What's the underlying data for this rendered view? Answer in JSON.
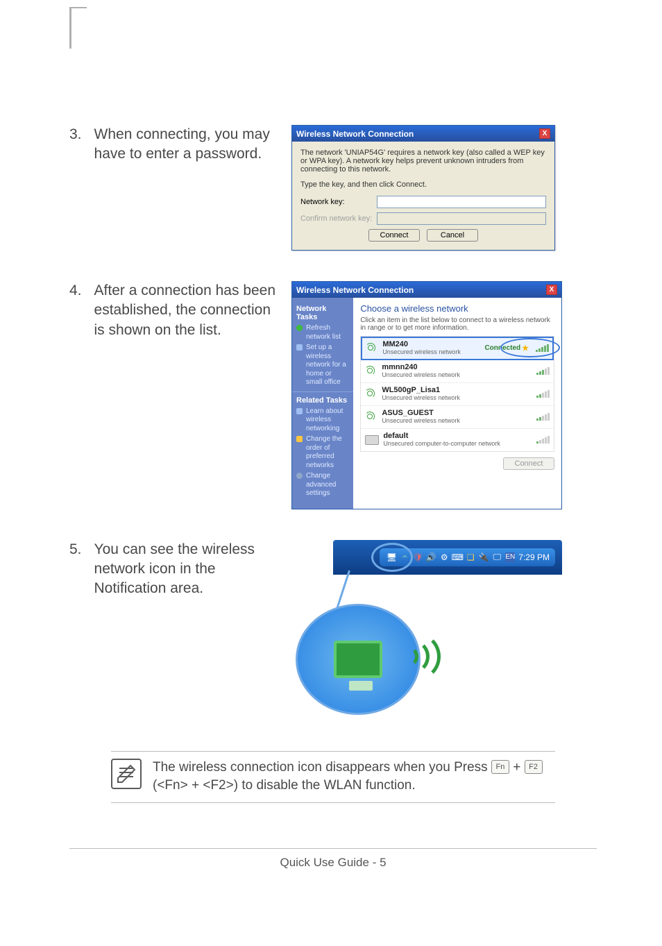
{
  "steps": {
    "s3": {
      "num": "3.",
      "text": "When connecting, you may have to enter a password."
    },
    "s4": {
      "num": "4.",
      "text": "After a connection has been established, the connection is shown on the list."
    },
    "s5": {
      "num": "5.",
      "text": "You can see the wireless network icon in the Notification area."
    }
  },
  "dialog_password": {
    "title": "Wireless Network Connection",
    "message": "The network 'UNIAP54G' requires a network key (also called a WEP key or WPA key). A network key helps prevent unknown intruders from connecting to this network.",
    "instruction": "Type the key, and then click Connect.",
    "label_key": "Network key:",
    "label_confirm": "Confirm network key:",
    "btn_connect": "Connect",
    "btn_cancel": "Cancel",
    "close_x": "X"
  },
  "dialog_list": {
    "title": "Wireless Network Connection",
    "close_x": "X",
    "side": {
      "hdr1": "Network Tasks",
      "task_refresh": "Refresh network list",
      "task_setup": "Set up a wireless network for a home or small office",
      "hdr2": "Related Tasks",
      "task_learn": "Learn about wireless networking",
      "task_order": "Change the order of preferred networks",
      "task_adv": "Change advanced settings"
    },
    "main": {
      "heading": "Choose a wireless network",
      "sub": "Click an item in the list below to connect to a wireless network in range or to get more information.",
      "connected": "Connected",
      "btn": "Connect"
    },
    "networks": [
      {
        "name": "MM240",
        "status": "Unsecured wireless network",
        "signal": 5,
        "connected": true,
        "type": "ap"
      },
      {
        "name": "mmnn240",
        "status": "Unsecured wireless network",
        "signal": 3,
        "connected": false,
        "type": "ap"
      },
      {
        "name": "WL500gP_Lisa1",
        "status": "Unsecured wireless network",
        "signal": 2,
        "connected": false,
        "type": "ap"
      },
      {
        "name": "ASUS_GUEST",
        "status": "Unsecured wireless network",
        "signal": 2,
        "connected": false,
        "type": "ap"
      },
      {
        "name": "default",
        "status": "Unsecured computer-to-computer network",
        "signal": 1,
        "connected": false,
        "type": "adhoc"
      }
    ]
  },
  "tray": {
    "time": "7:29 PM",
    "icons": [
      "pc-icon",
      "wifi-icon",
      "shield-icon",
      "volume-icon",
      "devices-icon",
      "keyboard-icon",
      "note-icon",
      "plug-icon",
      "monitor-icon",
      "lang-icon"
    ]
  },
  "note": {
    "text_before": "The wireless connection icon disappears when you Press ",
    "key_fn": "Fn",
    "plus1": " + ",
    "key_f2": "F2",
    "text_after": " (<Fn> + <F2>) to disable the WLAN function."
  },
  "footer": "Quick Use Guide - 5"
}
